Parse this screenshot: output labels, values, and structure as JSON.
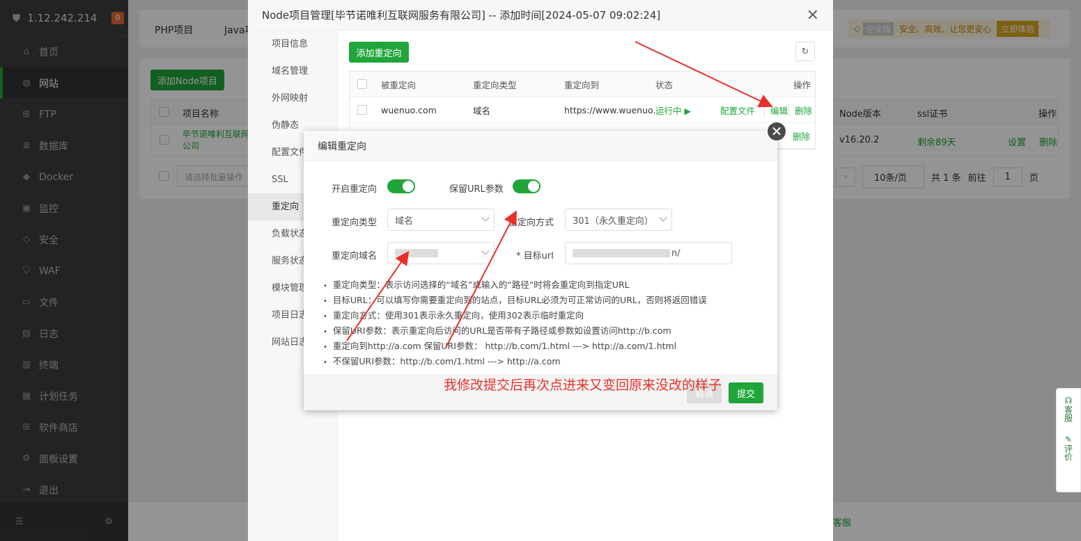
{
  "sidebar": {
    "ip": "1.12.242.214",
    "badge": "0",
    "items": [
      {
        "label": "首页",
        "icon": "home-icon",
        "glyph": "⌂"
      },
      {
        "label": "网站",
        "icon": "globe-icon",
        "glyph": "◍"
      },
      {
        "label": "FTP",
        "icon": "ftp-icon",
        "glyph": "⊞"
      },
      {
        "label": "数据库",
        "icon": "database-icon",
        "glyph": "≣"
      },
      {
        "label": "Docker",
        "icon": "docker-icon",
        "glyph": "◆"
      },
      {
        "label": "监控",
        "icon": "monitor-icon",
        "glyph": "▣"
      },
      {
        "label": "安全",
        "icon": "shield-icon",
        "glyph": "◇"
      },
      {
        "label": "WAF",
        "icon": "waf-icon",
        "glyph": "⛉"
      },
      {
        "label": "文件",
        "icon": "folder-icon",
        "glyph": "▭"
      },
      {
        "label": "日志",
        "icon": "log-icon",
        "glyph": "▤"
      },
      {
        "label": "终端",
        "icon": "terminal-icon",
        "glyph": "▥"
      },
      {
        "label": "计划任务",
        "icon": "calendar-icon",
        "glyph": "▦"
      },
      {
        "label": "软件商店",
        "icon": "grid-icon",
        "glyph": "⊞"
      },
      {
        "label": "面板设置",
        "icon": "settings-icon",
        "glyph": "⚙"
      },
      {
        "label": "退出",
        "icon": "logout-icon",
        "glyph": "⇥"
      }
    ]
  },
  "topbar": {
    "tab1": "PHP项目",
    "tab2": "Java项",
    "promo_badge": "企业版",
    "promo_text": "安全、高效、让您更安心",
    "promo_btn": "立即体验"
  },
  "bg_list": {
    "add_btn": "添加Node项目",
    "col_name": "项目名称",
    "col_node": "Node版本",
    "col_ssl": "ssl证书",
    "col_ops": "操作",
    "row_name": "毕节诺唯利互联网公司",
    "row_node": "v16.20.2",
    "row_ssl": "剩余89天",
    "row_set": "设置",
    "row_del": "删除",
    "batch_placeholder": "请选择批量操作",
    "page_size": "10条/页",
    "total": "共 1 条",
    "goto": "前往",
    "page": "1",
    "page_unit": "页",
    "footer_link": "客服"
  },
  "node_win": {
    "title": "Node项目管理[毕节诺唯利互联网服务有限公司] -- 添加时间[2024-05-07 09:02:24]",
    "nav": [
      "项目信息",
      "域名管理",
      "外网映射",
      "伪静态",
      "配置文件",
      "SSL",
      "重定向",
      "负载状态",
      "服务状态",
      "模块管理",
      "项目日志",
      "网站日志"
    ],
    "add_btn": "添加重定向",
    "th": [
      "被重定向",
      "重定向类型",
      "重定向到",
      "状态",
      "操作"
    ],
    "row": {
      "from": "wuenuo.com",
      "type": "域名",
      "to": "https://www.wuenuo.",
      "status": "运行中 ▶",
      "config": "配置文件",
      "edit": "编辑",
      "del": "删除"
    },
    "row2_del": "删除"
  },
  "dialog": {
    "title": "编辑重定向",
    "enable_label": "开启重定向",
    "keep_label": "保留URL参数",
    "type_label": "重定向类型",
    "type_value": "域名",
    "method_label": "重定向方式",
    "method_value": "301（永久重定向）",
    "domain_label": "重定向域名",
    "target_label": "* 目标url",
    "target_suffix": "n/",
    "tips": [
      "重定向类型：表示访问选择的“域名”或输入的“路径”时将会重定向到指定URL",
      "目标URL：可以填写你需要重定向到的站点，目标URL必须为可正常访问的URL，否则将返回错误",
      "重定向方式：使用301表示永久重定向，使用302表示临时重定向",
      "保留URI参数：表示重定向后访问的URL是否带有子路径或参数如设置访问http://b.com",
      "重定向到http://a.com 保留URI参数： http://b.com/1.html ---> http://a.com/1.html",
      "不保留URI参数：http://b.com/1.html ---> http://a.com"
    ],
    "cancel": "取消",
    "submit": "提交"
  },
  "annotation": "我修改提交后再次点进来又变回原来没改的样子",
  "widget": {
    "service": "客服",
    "review": "评价"
  }
}
